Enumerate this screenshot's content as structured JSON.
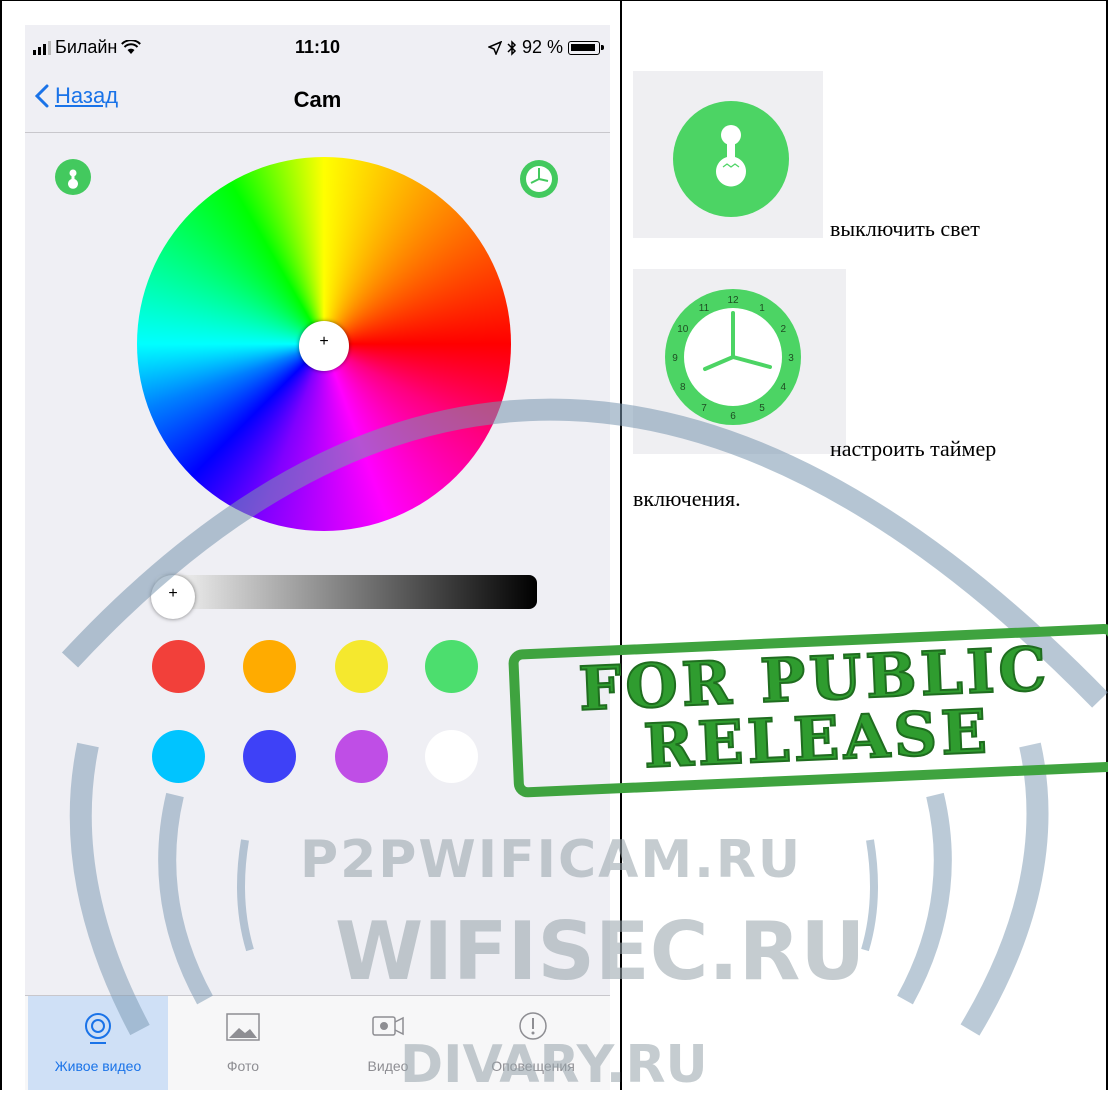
{
  "status_bar": {
    "carrier": "Билайн",
    "time": "11:10",
    "battery_percent": "92 %"
  },
  "nav": {
    "back_label": "Назад",
    "title": "Cam"
  },
  "color_picker": {
    "brightness_level": 0,
    "preset_colors": [
      "#f2403a",
      "#ffab00",
      "#f5e82e",
      "#4cde6e",
      "#00c4ff",
      "#3e41f7",
      "#bf4ee6",
      "#ffffff"
    ]
  },
  "tabs": [
    {
      "label": "Живое видео",
      "icon": "live-video-icon",
      "active": true
    },
    {
      "label": "Фото",
      "icon": "photo-icon",
      "active": false
    },
    {
      "label": "Видео",
      "icon": "video-camera-icon",
      "active": false
    },
    {
      "label": "Оповещения",
      "icon": "alert-icon",
      "active": false
    }
  ],
  "doc": {
    "lamp_caption": "выключить свет",
    "timer_caption_line1": "настроить таймер",
    "timer_caption_line2": "включения."
  },
  "clock_numbers": [
    "12",
    "1",
    "2",
    "3",
    "4",
    "5",
    "6",
    "7",
    "8",
    "9",
    "10",
    "11"
  ],
  "watermark": {
    "stamp_line1": "FOR PUBLIC",
    "stamp_line2": "RELEASE",
    "site1": "P2PWIFICAM.RU",
    "site2": "WIFISEC.RU",
    "site3": "DIVARY.RU"
  },
  "colors": {
    "accent": "#1a73e8",
    "green": "#43c95e",
    "stamp_green": "#3fa33f"
  }
}
